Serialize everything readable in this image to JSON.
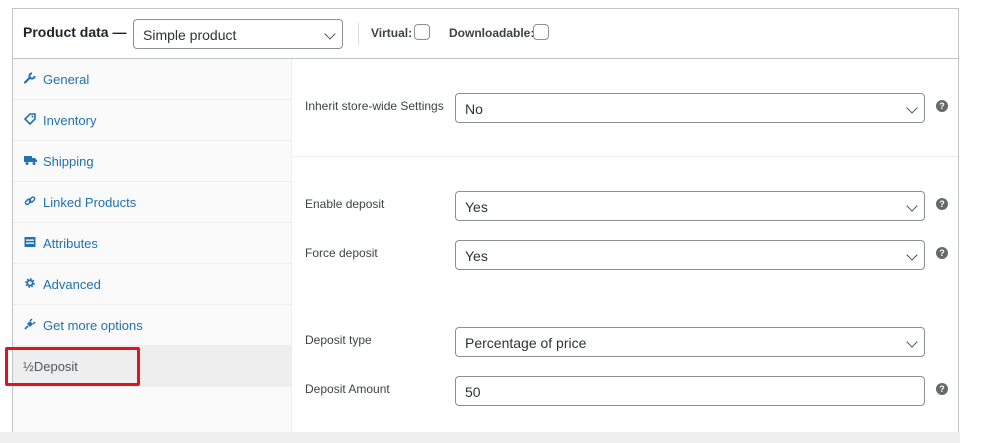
{
  "header": {
    "title": "Product data —",
    "product_type": "Simple product",
    "virtual_label": "Virtual:",
    "downloadable_label": "Downloadable:"
  },
  "sidebar": {
    "items": [
      {
        "label": "General",
        "icon": "wrench-icon"
      },
      {
        "label": "Inventory",
        "icon": "tag-icon"
      },
      {
        "label": "Shipping",
        "icon": "truck-icon"
      },
      {
        "label": "Linked Products",
        "icon": "link-icon"
      },
      {
        "label": "Attributes",
        "icon": "list-icon"
      },
      {
        "label": "Advanced",
        "icon": "gear-icon"
      },
      {
        "label": "Get more options",
        "icon": "plugin-icon"
      },
      {
        "label": "½Deposit",
        "icon": ""
      }
    ],
    "active_item": "½Deposit"
  },
  "fields": {
    "inherit": {
      "label": "Inherit store-wide Settings",
      "value": "No"
    },
    "enable_deposit": {
      "label": "Enable deposit",
      "value": "Yes"
    },
    "force_deposit": {
      "label": "Force deposit",
      "value": "Yes"
    },
    "deposit_type": {
      "label": "Deposit type",
      "value": "Percentage of price"
    },
    "deposit_amount": {
      "label": "Deposit Amount",
      "value": "50"
    }
  },
  "help_glyph": "?",
  "colors": {
    "link": "#2271b1",
    "highlight": "#e0141e",
    "border": "#c3c4c7"
  }
}
